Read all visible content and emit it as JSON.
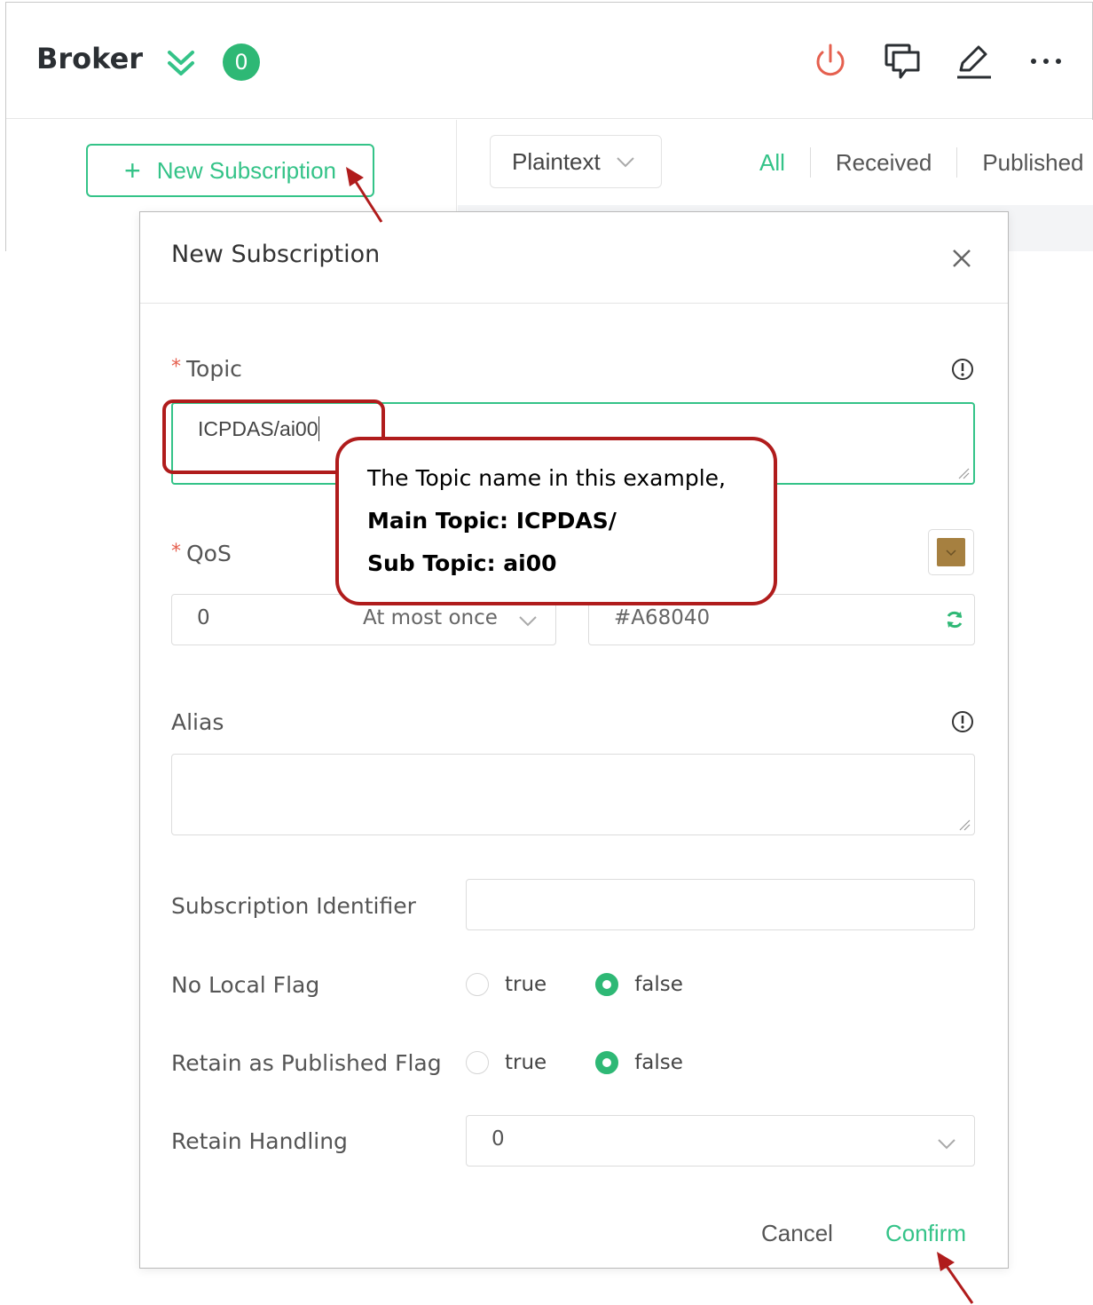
{
  "header": {
    "title": "Broker",
    "count_badge": "0",
    "icons": [
      "chevron-down-double-icon",
      "power-icon",
      "chat-icon",
      "edit-icon",
      "more-icon"
    ]
  },
  "left_pane": {
    "new_subscription_label": "New Subscription"
  },
  "message_toolbar": {
    "format": "Plaintext",
    "tabs": [
      "All",
      "Received",
      "Published"
    ],
    "active_tab": "All"
  },
  "dialog": {
    "title": "New Subscription",
    "topic": {
      "label": "Topic",
      "required_mark": "*",
      "value": "ICPDAS/ai00"
    },
    "qos": {
      "label": "QoS",
      "required_mark": "*",
      "value": "0",
      "description": "At most once"
    },
    "color": {
      "value": "#A68040"
    },
    "alias": {
      "label": "Alias",
      "value": ""
    },
    "subscription_identifier": {
      "label": "Subscription Identifier",
      "value": ""
    },
    "no_local_flag": {
      "label": "No Local Flag",
      "options": [
        "true",
        "false"
      ],
      "selected": "false"
    },
    "retain_as_published_flag": {
      "label": "Retain as Published Flag",
      "options": [
        "true",
        "false"
      ],
      "selected": "false"
    },
    "retain_handling": {
      "label": "Retain Handling",
      "value": "0"
    },
    "cancel_label": "Cancel",
    "confirm_label": "Confirm"
  },
  "annotation": {
    "line1": "The Topic name in this example,",
    "line2": "Main Topic: ICPDAS/",
    "line3": "Sub Topic: ai00"
  },
  "colors": {
    "accent": "#34c388",
    "annotation": "#b01c1c",
    "power": "#e5604f",
    "swatch": "#A68040"
  }
}
